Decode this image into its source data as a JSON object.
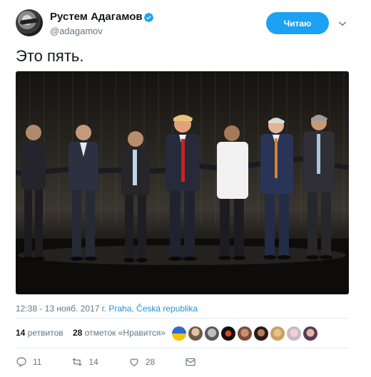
{
  "header": {
    "name": "Рустем Адагамов",
    "handle": "@adagamov",
    "follow_label": "Читаю"
  },
  "tweet": {
    "text": "Это пять."
  },
  "meta": {
    "timestamp": "12:38 - 13 нояб. 2017 г.",
    "location": "Praha, Česká republika"
  },
  "stats": {
    "retweets_count": "14",
    "retweets_label": "ретвитов",
    "likes_count": "28",
    "likes_label": "отметок «Нравится»"
  },
  "actions": {
    "reply_count": "11",
    "retweet_count": "14",
    "like_count": "28"
  },
  "colors": {
    "accent": "#1da1f2",
    "link": "#1b95e0",
    "secondary_text": "#657786"
  }
}
